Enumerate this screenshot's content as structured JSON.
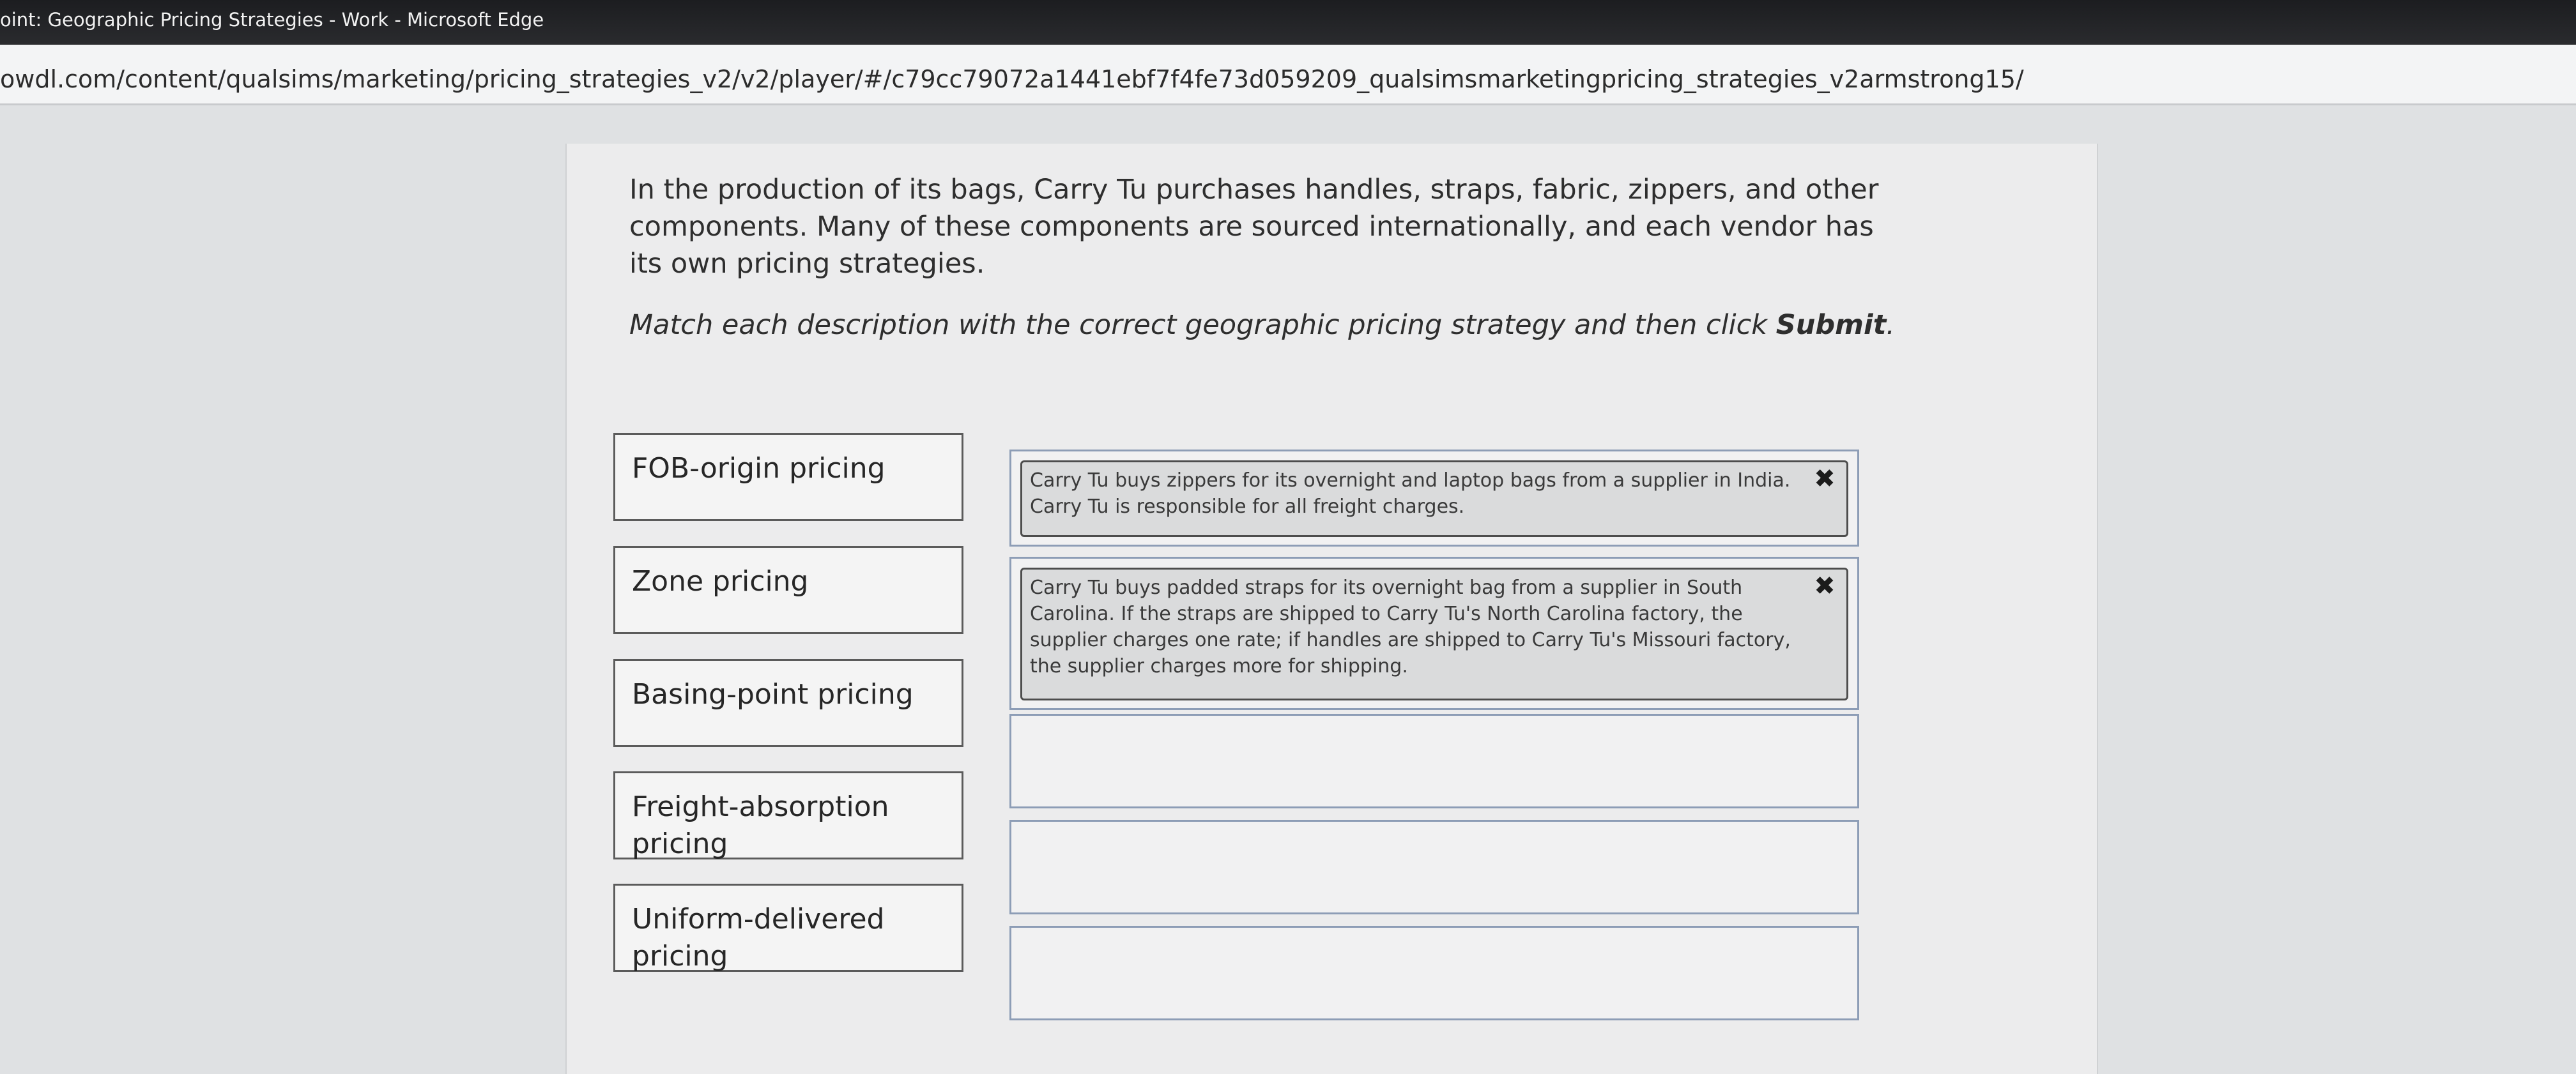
{
  "window": {
    "title": "oint: Geographic Pricing Strategies - Work - Microsoft Edge"
  },
  "address_bar": {
    "url": "owdl.com/content/qualsims/marketing/pricing_strategies_v2/v2/player/#/c79cc79072a1441ebf7f4fe73d059209_qualsimsmarketingpricing_strategies_v2armstrong15/"
  },
  "activity": {
    "intro": "In the production of its bags, Carry Tu purchases handles, straps, fabric, zippers, and other components. Many of these components are sourced internationally, and each vendor has its own pricing strategies.",
    "instruction_prefix": "Match each description with the correct geographic pricing strategy and then click ",
    "instruction_action": "Submit",
    "instruction_suffix": ".",
    "terms": [
      {
        "label": "FOB-origin pricing"
      },
      {
        "label": "Zone pricing"
      },
      {
        "label": "Basing-point pricing"
      },
      {
        "label": "Freight-absorption pricing"
      },
      {
        "label": "Uniform-delivered pricing"
      }
    ],
    "targets": [
      {
        "text": "Carry Tu buys zippers for its overnight and laptop bags from a supplier in India. Carry Tu is responsible for all freight charges.",
        "remove_glyph": "✖"
      },
      {
        "text": "Carry Tu buys padded straps for its overnight bag from a supplier in South Carolina. If the straps are shipped to Carry Tu's North Carolina factory, the supplier charges one rate; if handles are shipped to Carry Tu's Missouri factory, the supplier charges more for shipping.",
        "remove_glyph": "✖"
      },
      {
        "text": ""
      },
      {
        "text": ""
      },
      {
        "text": ""
      }
    ]
  }
}
